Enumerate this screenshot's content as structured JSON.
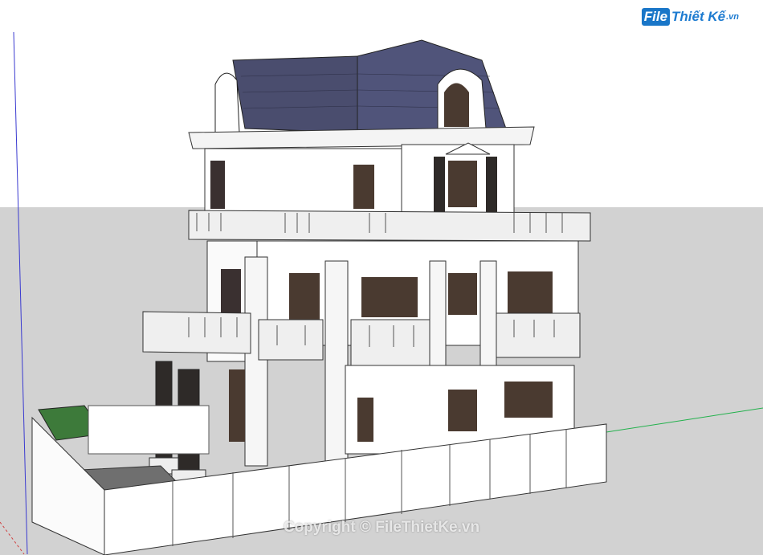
{
  "viewport": {
    "sky_color": "#ffffff",
    "ground_color": "#d2d2d2",
    "axis_colors": {
      "green": "#22b14c",
      "blue": "#3a3ad0",
      "red": "#d04040"
    }
  },
  "logo": {
    "file_text": "File",
    "brand_text": "Thiết Kế",
    "domain_text": ".vn",
    "icon": "filethietke-logo-icon"
  },
  "watermark": {
    "text": "Copyright © FileThietKe.vn"
  },
  "model": {
    "subject": "classical-villa-3d-model",
    "roof_color": "#4a4d6e",
    "wall_color": "#ffffff",
    "window_color": "#4a3a30",
    "fence_color": "#ffffff"
  }
}
